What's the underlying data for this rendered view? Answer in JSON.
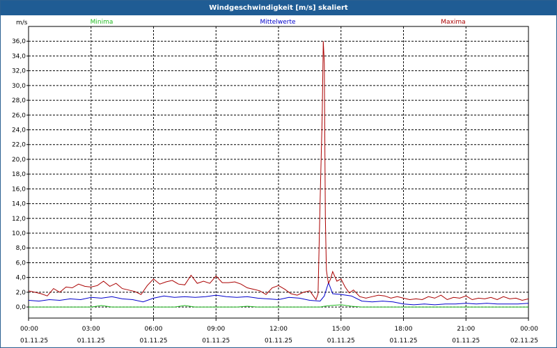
{
  "window": {
    "title": "Windgeschwindigkeit [m/s] skaliert"
  },
  "chart_data": {
    "type": "line",
    "title": "Windgeschwindigkeit [m/s] skaliert",
    "y_unit_label": "m/s",
    "ylim": [
      -1.5,
      38.0
    ],
    "xlim": [
      0,
      24
    ],
    "y_ticks": [
      "0,0",
      "2,0",
      "4,0",
      "6,0",
      "8,0",
      "10,0",
      "12,0",
      "14,0",
      "16,0",
      "18,0",
      "20,0",
      "22,0",
      "24,0",
      "26,0",
      "28,0",
      "30,0",
      "32,0",
      "34,0",
      "36,0"
    ],
    "x_ticks": [
      {
        "time": "00:00",
        "date": "01.11.25"
      },
      {
        "time": "03:00",
        "date": "01.11.25"
      },
      {
        "time": "06:00",
        "date": "01.11.25"
      },
      {
        "time": "09:00",
        "date": "01.11.25"
      },
      {
        "time": "12:00",
        "date": "01.11.25"
      },
      {
        "time": "15:00",
        "date": "01.11.25"
      },
      {
        "time": "18:00",
        "date": "01.11.25"
      },
      {
        "time": "21:00",
        "date": "01.11.25"
      },
      {
        "time": "00:00",
        "date": "02.11.25"
      }
    ],
    "grid": true,
    "legend_placement": "top",
    "series": [
      {
        "name": "Minima",
        "color": "#22bb22",
        "x": [
          0,
          1,
          2,
          3,
          3.5,
          4,
          5,
          6,
          7,
          7.5,
          8,
          9,
          10,
          10.5,
          11,
          12,
          13,
          14,
          14.2,
          14.5,
          15,
          15.5,
          16,
          17,
          18,
          19,
          20,
          21,
          22,
          23,
          24
        ],
        "values": [
          0,
          0,
          0,
          0,
          0.2,
          0,
          0,
          0,
          0,
          0.2,
          0,
          0,
          0,
          0.1,
          0,
          0,
          0,
          0,
          0.1,
          0.2,
          0.3,
          0.1,
          0,
          0,
          0,
          0,
          0,
          0,
          0,
          0,
          0
        ]
      },
      {
        "name": "Mittelwerte",
        "color": "#0000cc",
        "x": [
          0,
          0.5,
          1,
          1.5,
          2,
          2.5,
          3,
          3.5,
          4,
          4.5,
          5,
          5.5,
          6,
          6.5,
          7,
          7.5,
          8,
          8.5,
          9,
          9.5,
          10,
          10.5,
          11,
          11.5,
          12,
          12.5,
          13,
          13.5,
          14,
          14.2,
          14.4,
          14.6,
          15,
          15.5,
          16,
          16.5,
          17,
          17.5,
          18,
          18.5,
          19,
          19.5,
          20,
          20.5,
          21,
          21.5,
          22,
          22.5,
          23,
          23.5,
          24
        ],
        "values": [
          0.9,
          0.8,
          1.0,
          0.9,
          1.1,
          1.0,
          1.3,
          1.2,
          1.4,
          1.1,
          1.0,
          0.7,
          1.2,
          1.5,
          1.3,
          1.4,
          1.3,
          1.4,
          1.6,
          1.4,
          1.3,
          1.4,
          1.2,
          1.1,
          1.0,
          1.3,
          1.2,
          0.9,
          0.8,
          1.5,
          3.3,
          1.8,
          1.7,
          1.5,
          0.8,
          0.7,
          0.8,
          0.7,
          0.4,
          0.3,
          0.4,
          0.3,
          0.4,
          0.4,
          0.5,
          0.4,
          0.5,
          0.4,
          0.4,
          0.4,
          0.5
        ]
      },
      {
        "name": "Maxima",
        "color": "#aa0000",
        "x": [
          0,
          0.3,
          0.6,
          0.9,
          1.2,
          1.5,
          1.8,
          2.1,
          2.4,
          2.7,
          3.0,
          3.3,
          3.6,
          3.9,
          4.2,
          4.5,
          4.8,
          5.1,
          5.4,
          5.7,
          6.0,
          6.3,
          6.6,
          6.9,
          7.2,
          7.5,
          7.8,
          8.1,
          8.4,
          8.7,
          9.0,
          9.3,
          9.6,
          9.9,
          10.2,
          10.5,
          10.8,
          11.1,
          11.4,
          11.7,
          12.0,
          12.3,
          12.6,
          12.9,
          13.2,
          13.5,
          13.8,
          13.9,
          14.0,
          14.1,
          14.15,
          14.2,
          14.25,
          14.3,
          14.35,
          14.4,
          14.5,
          14.6,
          14.8,
          15.0,
          15.2,
          15.4,
          15.6,
          15.9,
          16.2,
          16.5,
          16.8,
          17.1,
          17.4,
          17.7,
          18.0,
          18.3,
          18.6,
          18.9,
          19.2,
          19.5,
          19.8,
          20.1,
          20.4,
          20.7,
          21.0,
          21.3,
          21.6,
          21.9,
          22.2,
          22.5,
          22.8,
          23.1,
          23.4,
          23.7,
          24.0
        ],
        "values": [
          2.2,
          2.0,
          1.8,
          1.5,
          2.5,
          2.0,
          2.7,
          2.6,
          3.1,
          2.8,
          2.7,
          2.9,
          3.5,
          2.8,
          3.2,
          2.5,
          2.3,
          2.1,
          1.7,
          2.9,
          3.8,
          3.1,
          3.4,
          3.6,
          3.1,
          3.0,
          4.3,
          3.2,
          3.5,
          3.2,
          4.2,
          3.3,
          3.3,
          3.4,
          3.1,
          2.6,
          2.4,
          2.2,
          1.7,
          2.6,
          2.9,
          2.4,
          1.8,
          1.6,
          2.0,
          2.2,
          1.0,
          1.8,
          14.5,
          26.0,
          36.0,
          33.0,
          12.0,
          5.0,
          4.0,
          3.2,
          3.8,
          4.8,
          3.5,
          3.8,
          2.7,
          1.9,
          2.3,
          1.4,
          1.2,
          1.4,
          1.6,
          1.5,
          1.2,
          1.4,
          1.2,
          1.0,
          1.1,
          1.0,
          1.4,
          1.2,
          1.6,
          1.0,
          1.3,
          1.2,
          1.5,
          1.0,
          1.2,
          1.1,
          1.3,
          1.0,
          1.4,
          1.1,
          1.2,
          0.9,
          1.1
        ]
      }
    ]
  }
}
